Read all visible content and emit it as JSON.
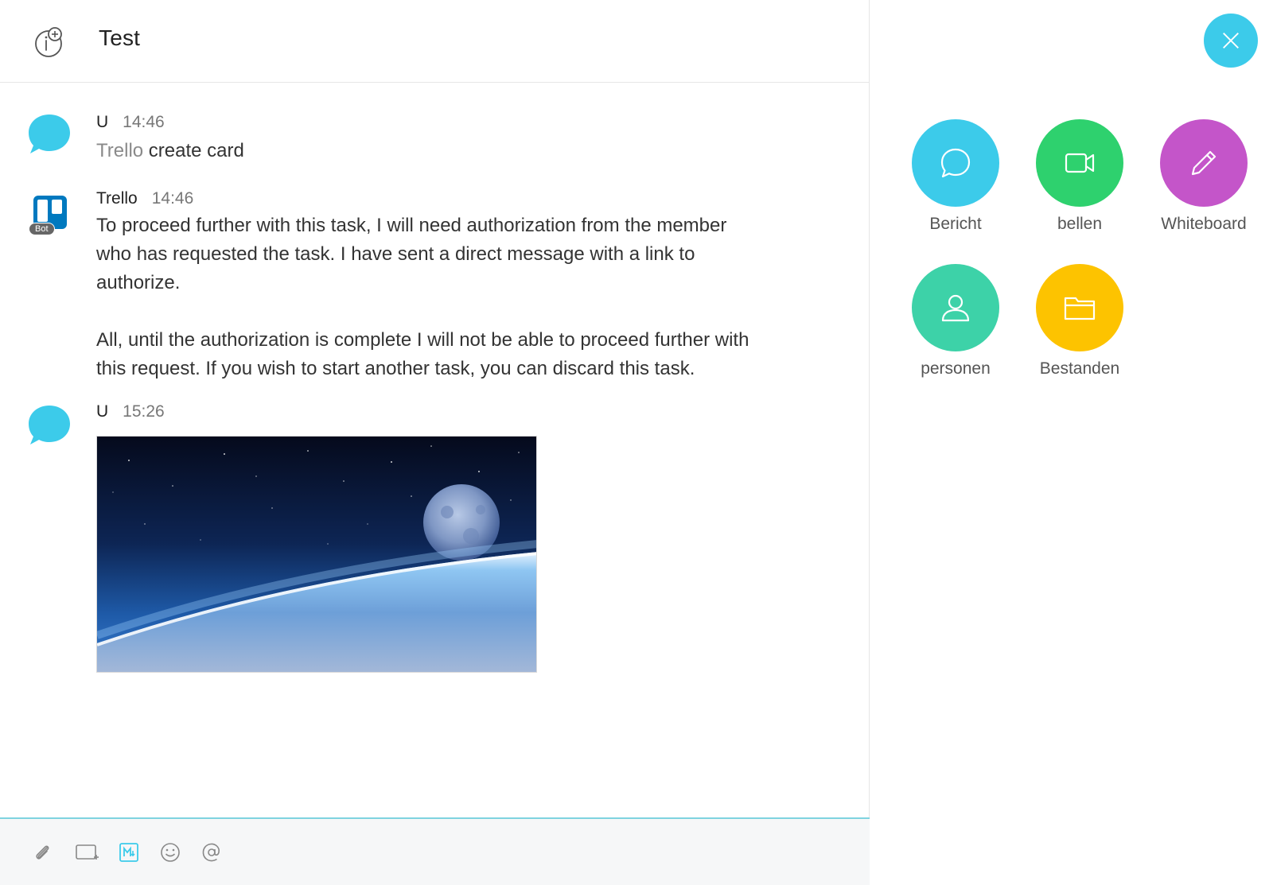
{
  "header": {
    "title": "Test",
    "space_icon": "space-info-icon"
  },
  "messages": [
    {
      "sender": "U",
      "time": "14:46",
      "mention": "Trello",
      "text": " create card",
      "avatar": "chat-bubble-avatar"
    },
    {
      "sender": "Trello",
      "time": "14:46",
      "badge": "Bot",
      "avatar": "trello-logo",
      "paragraph_1": "To proceed further with this task, I will need authorization from the member who has requested the task. I have sent a direct message with a link to authorize.",
      "paragraph_2": "All, until the authorization is complete I will not be able to proceed further with this request. If you wish to start another task, you can discard this task."
    },
    {
      "sender": "U",
      "time": "15:26",
      "avatar": "chat-bubble-avatar",
      "attachment": "space-earth-moon-image"
    }
  ],
  "composer": {
    "tools": [
      "attach-icon",
      "whiteboard-add-icon",
      "markdown-icon",
      "emoji-icon",
      "mention-icon"
    ]
  },
  "panel": {
    "close_icon": "close-icon",
    "actions": [
      {
        "label": "Bericht",
        "icon": "message-icon",
        "color": "#3ccbea"
      },
      {
        "label": "bellen",
        "icon": "video-icon",
        "color": "#2ed16e"
      },
      {
        "label": "Whiteboard",
        "icon": "pencil-icon",
        "color": "#c455c9"
      },
      {
        "label": "personen",
        "icon": "person-icon",
        "color": "#3dd2a8"
      },
      {
        "label": "Bestanden",
        "icon": "folder-icon",
        "color": "#fdc300"
      }
    ]
  }
}
